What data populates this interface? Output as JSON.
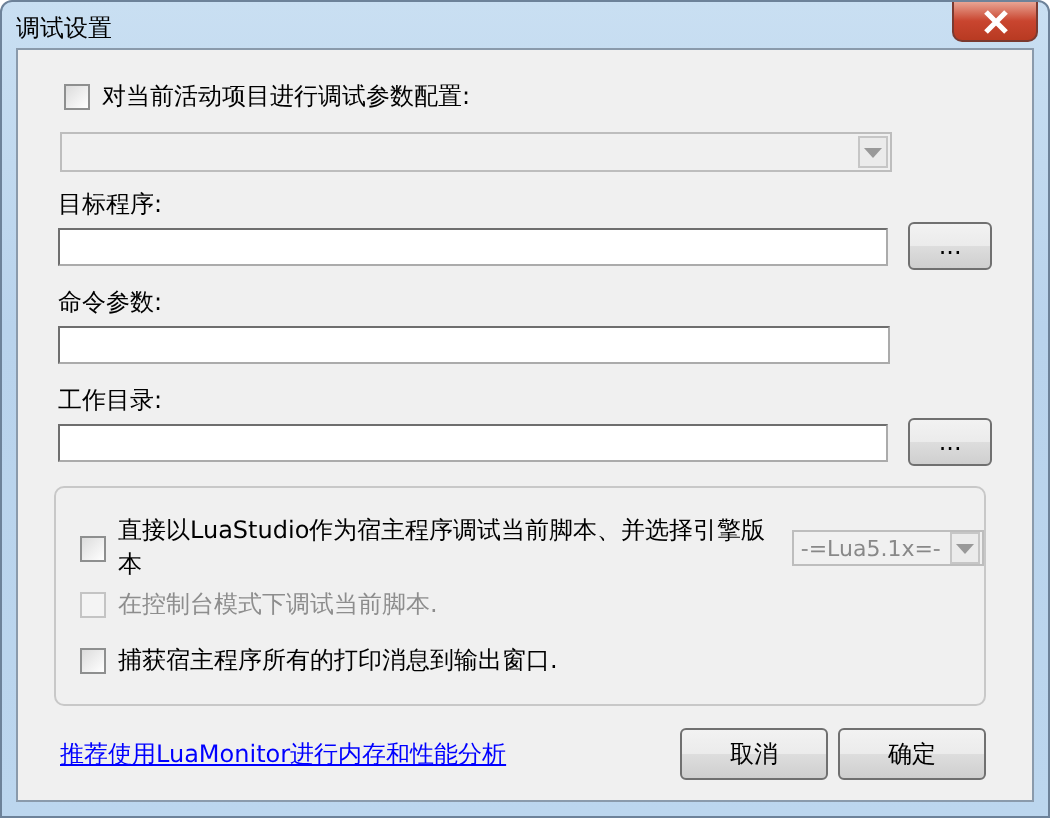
{
  "window": {
    "title": "调试设置"
  },
  "project_config": {
    "label": "对当前活动项目进行调试参数配置:",
    "checked": false,
    "combo": {
      "disabled": true
    }
  },
  "fields": [
    {
      "label": "目标程序:",
      "browse": "..."
    },
    {
      "label": "命令参数:"
    },
    {
      "label": "工作目录:",
      "browse": "..."
    }
  ],
  "options": [
    {
      "kind": "combo",
      "label": "直接以LuaStudio作为宿主程序调试当前脚本、并选择引擎版本",
      "checked": false,
      "disabled": false,
      "combo": {
        "value": "-=Lua5.1x=-",
        "disabled": true
      }
    },
    {
      "kind": "plain",
      "label": "在控制台模式下调试当前脚本.",
      "checked": false,
      "disabled": true
    },
    {
      "kind": "plain",
      "label": "捕获宿主程序所有的打印消息到输出窗口.",
      "checked": false,
      "disabled": false
    }
  ],
  "link": "推荐使用LuaMonitor进行内存和性能分析",
  "buttons": [
    "取消",
    "确定"
  ]
}
